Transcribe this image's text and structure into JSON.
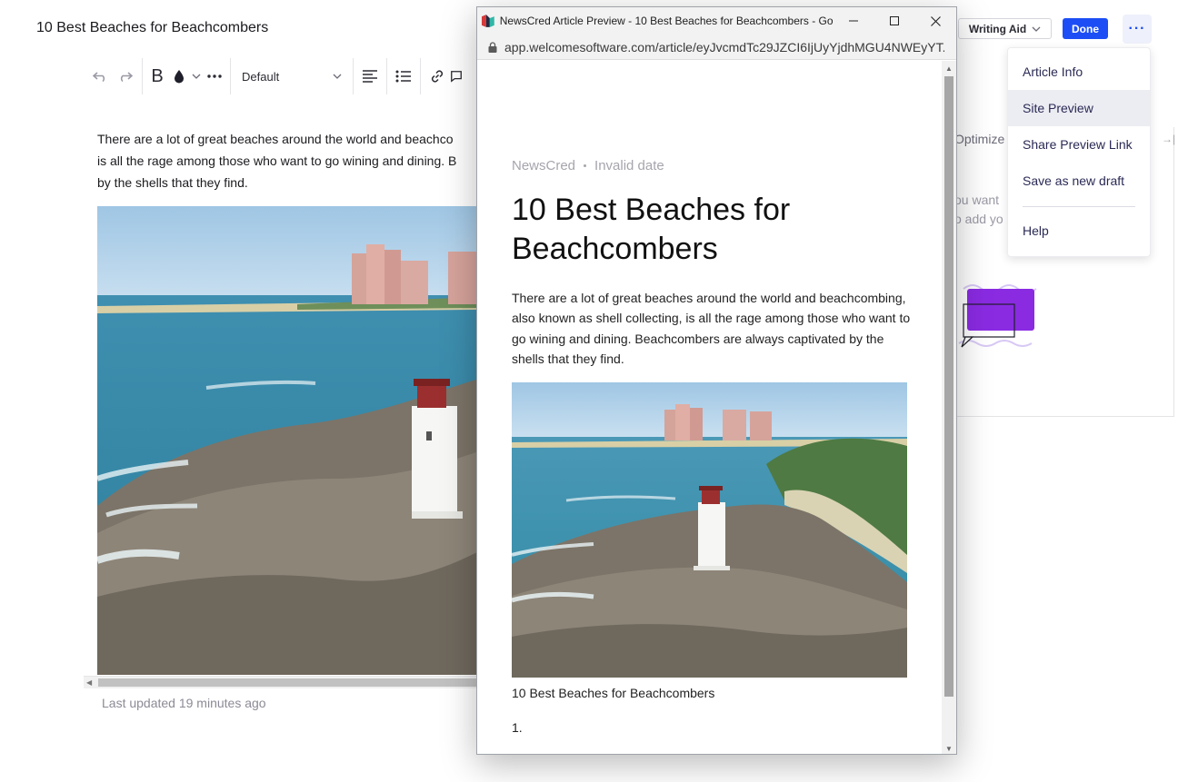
{
  "editor": {
    "title": "10 Best Beaches for Beachcombers",
    "toolbar": {
      "undo_icon": "undo-icon",
      "redo_icon": "redo-icon",
      "bold_label": "B",
      "style_select_value": "Default"
    },
    "body_lines": [
      "There are a lot of great beaches around the world and beachco",
      "is all the rage among those who want to go wining and dining. B",
      "by the shells that they find."
    ],
    "last_updated": "Last updated 19 minutes ago"
  },
  "header": {
    "writing_aid_label": "Writing Aid",
    "done_label": "Done",
    "more_label": "···"
  },
  "side_panel": {
    "tab_label": "Optimize",
    "hint_lines": [
      "ou want",
      "o add yo"
    ]
  },
  "menu": {
    "items": [
      {
        "label": "Article Info"
      },
      {
        "label": "Site Preview",
        "active": true
      },
      {
        "label": "Share Preview Link"
      },
      {
        "label": "Save as new draft"
      },
      {
        "label": "Help"
      }
    ]
  },
  "popup": {
    "window_title": "NewsCred Article Preview - 10 Best Beaches for Beachcombers - Go...",
    "url": "app.welcomesoftware.com/article/eyJvcmdTc29JZCI6IjUyYjdhMGU4NWEyYT...",
    "meta_source": "NewsCred",
    "meta_date": "Invalid date",
    "article_title": "10 Best Beaches for Beachcombers",
    "body": "There are a lot of great beaches around the world and beachcombing, also known as shell collecting, is all the rage among those who want to go wining and dining. Beachcombers are always captivated by the shells that they find.",
    "caption": "10 Best Beaches for Beachcombers",
    "list_marker": "1."
  },
  "colors": {
    "accent": "#1d4ef5",
    "illustration_purple": "#8a2be2"
  }
}
